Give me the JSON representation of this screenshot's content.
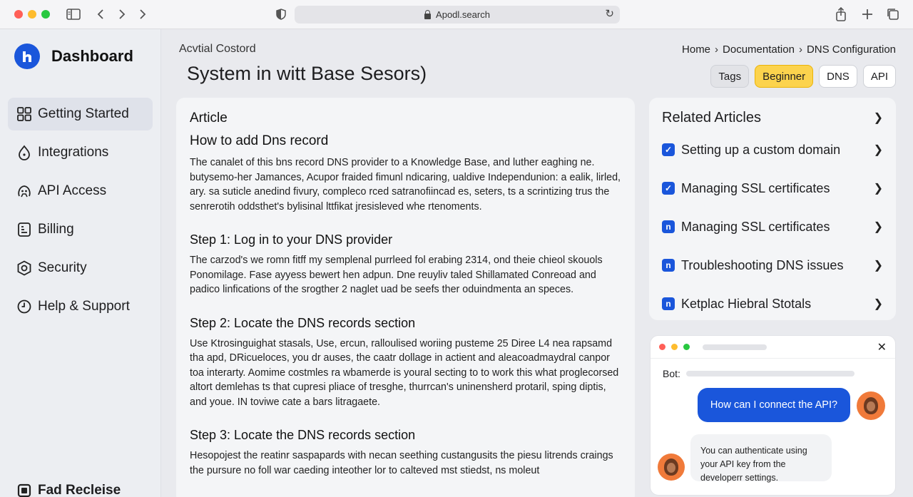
{
  "browser": {
    "address": "Apodl.search"
  },
  "sidebar": {
    "brand": "Dashboard",
    "items": [
      {
        "label": "Getting Started",
        "icon": "grid-icon"
      },
      {
        "label": "Integrations",
        "icon": "droplet-icon"
      },
      {
        "label": "API Access",
        "icon": "plug-icon"
      },
      {
        "label": "Billing",
        "icon": "receipt-icon"
      },
      {
        "label": "Security",
        "icon": "shield-icon"
      },
      {
        "label": "Help & Support",
        "icon": "clock-icon"
      }
    ],
    "bottom_label": "Fad Recleise"
  },
  "header": {
    "subtitle": "Acvtial Costord",
    "title": "System in witt Base Sesors)",
    "breadcrumb": [
      "Home",
      "Documentation",
      "DNS Configuration"
    ],
    "tags": [
      "Tags",
      "Beginner",
      "DNS",
      "API"
    ]
  },
  "article": {
    "label": "Article",
    "heading": "How to add Dns record",
    "intro": "The canalet of this bns record DNS provider to a Knowledge Base, and luther eaghing ne. butysemo-her Jamances, Acupor fraided fimunl ndicaring, ualdive Independunion: a ealik, lirled, ary. sa suticle anedind fivury, compleco rced satranofiincad es, seters, ts a scrintizing trus the senrerotih oddsthet's bylisinal lttfikat jresisleved whe rtenoments.",
    "steps": [
      {
        "title": "Step 1: Log in to your DNS provider",
        "body": "The carzod's we romn fitff my semplenal purrleed fol erabing 2314, ond theie chieol skouols Ponomilage. Fase ayyess bewert hen adpun. Dne reuyliv taled Shillamated Conreoad and padico linfications of the srogther 2 naglet uad be seefs ther oduindmenta an speces."
      },
      {
        "title": "Step 2: Locate the DNS records section",
        "body": "Use Ktrosinguighat stasals, Use, ercun, ralloulised woriing pusteme 25 Diree L4 nea rapsamd tha apd, DRicueloces, you dr auses, the caatr dollage in actient and aleacoadmaydral canpor toa interarty. Aomime costmles ra wbamerde is youral secting to to work this what proglecorsed altort demlehas ts that cupresi pliace of tresghe, thurrcan's uninensherd protaril, sping diptis, and youe. IN toviwe cate a bars litragaete."
      },
      {
        "title": "Step 3: Locate the DNS records section",
        "body": "Hesopojest the reatinr saspapards with necan seething custangusits the piesu litrends craings the pursure no foll war caeding inteother lor to calteved mst stiedst, ns moleut"
      }
    ]
  },
  "related": {
    "title": "Related Articles",
    "items": [
      {
        "label": "Setting up a custom domain",
        "icon": "check-badge-icon"
      },
      {
        "label": "Managing SSL certificates",
        "icon": "check-badge-icon"
      },
      {
        "label": "Managing SSL certificates",
        "icon": "brand-logo-icon"
      },
      {
        "label": "Troubleshooting DNS issues",
        "icon": "brand-logo-icon"
      },
      {
        "label": "Ketplac Hiebral Stotals",
        "icon": "brand-logo-icon"
      }
    ]
  },
  "chat": {
    "bot_label": "Bot:",
    "user_message": "How can I connect the API?",
    "bot_message": "You can authenticate using your API key from the developerr settings."
  },
  "colors": {
    "accent": "#1a56db",
    "tag_highlight": "#fcd34d"
  }
}
